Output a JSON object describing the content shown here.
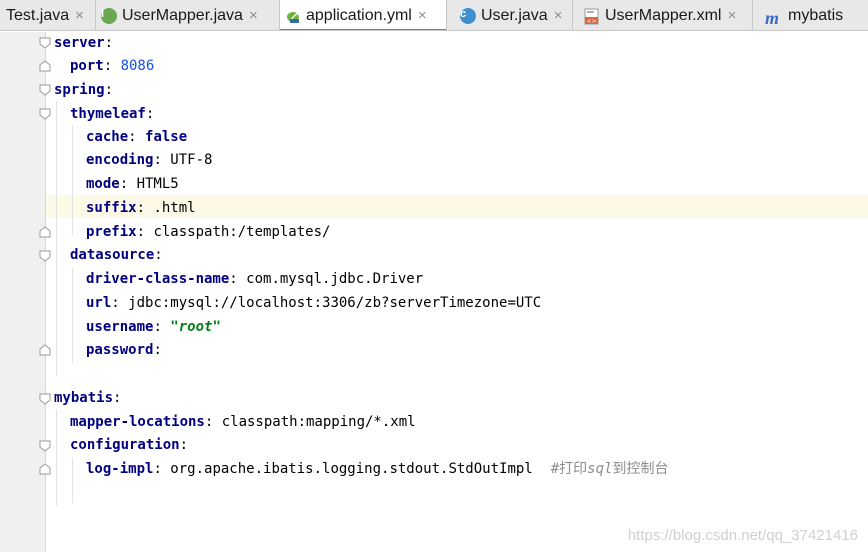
{
  "tabs": [
    {
      "label": "Test.java",
      "icon": "java-class-icon",
      "active": false
    },
    {
      "label": "UserMapper.java",
      "icon": "interface-icon",
      "active": false
    },
    {
      "label": "application.yml",
      "icon": "spring-leaf-icon",
      "active": true
    },
    {
      "label": "User.java",
      "icon": "class-icon",
      "active": false
    },
    {
      "label": "UserMapper.xml",
      "icon": "xml-file-icon",
      "active": false
    },
    {
      "label": "mybatis",
      "icon": "mybatis-icon",
      "active": false
    }
  ],
  "icon_letters": {
    "interface": "I",
    "class": "c",
    "mybatis": "m"
  },
  "close_glyph": "×",
  "colors": {
    "key": "#000080",
    "number": "#1750eb",
    "string": "#067d17",
    "comment": "#8c8c8c",
    "active_tab_underline": "#4a88c7",
    "current_line": "#fcfae6"
  },
  "code": {
    "server": {
      "key": "server",
      "sep": ":"
    },
    "port": {
      "key": "port",
      "sep": ": ",
      "value": "8086"
    },
    "spring": {
      "key": "spring",
      "sep": ":"
    },
    "thymeleaf": {
      "key": "thymeleaf",
      "sep": ":"
    },
    "cache": {
      "key": "cache",
      "sep": ": ",
      "value": "false"
    },
    "encoding": {
      "key": "encoding",
      "sep": ": ",
      "value": "UTF-8"
    },
    "mode": {
      "key": "mode",
      "sep": ": ",
      "value": "HTML5"
    },
    "suffix": {
      "key": "suffix",
      "sep": ": ",
      "value": ".html"
    },
    "prefix": {
      "key": "prefix",
      "sep": ": ",
      "value": "classpath:/templates/"
    },
    "datasource": {
      "key": "datasource",
      "sep": ":"
    },
    "driver": {
      "key": "driver-class-name",
      "sep": ": ",
      "value": "com.mysql.jdbc.Driver"
    },
    "url": {
      "key": "url",
      "sep": ": ",
      "value": "jdbc:mysql://localhost:3306/zb?serverTimezone=UTC"
    },
    "username": {
      "key": "username",
      "sep": ": ",
      "value": "\"root\""
    },
    "password": {
      "key": "password",
      "sep": ":"
    },
    "mybatis": {
      "key": "mybatis",
      "sep": ":"
    },
    "mapper_locations": {
      "key": "mapper-locations",
      "sep": ": ",
      "value": "classpath:mapping/*.xml"
    },
    "configuration": {
      "key": "configuration",
      "sep": ":"
    },
    "log_impl": {
      "key": "log-impl",
      "sep": ": ",
      "value": "org.apache.ibatis.logging.stdout.StdOutImpl",
      "comment_prefix": "#打印",
      "comment_em": "sql",
      "comment_suffix": "到控制台"
    }
  },
  "watermark": "https://blog.csdn.net/qq_37421416"
}
